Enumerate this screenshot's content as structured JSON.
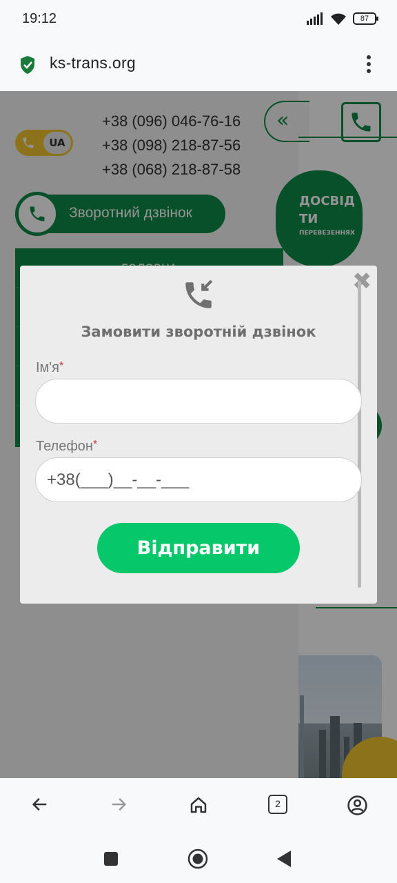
{
  "status_bar": {
    "time": "19:12",
    "battery": "87"
  },
  "browser": {
    "url": "ks-trans.org",
    "tab_count": "2"
  },
  "background_page": {
    "phones": [
      "+38 (096) 046-76-16",
      "+38 (098) 218-87-56",
      "+38 (068) 218-87-58"
    ],
    "language": "UA",
    "callback_label": "Зворотний дзвінок",
    "menu_first": "ГОЛОВНА",
    "collapse_glyph": "«",
    "oval_line1": "ДОСВІД",
    "oval_line2": "ТИ",
    "oval_line3": "ПЕРЕВЕЗЕННЯХ"
  },
  "modal": {
    "title": "Замовити зворотній дзвінок",
    "close_glyph": "✖",
    "name_label": "Ім'я",
    "required_mark": "*",
    "name_value": "",
    "phone_label": "Телефон",
    "phone_placeholder": "+38(___)__-__-___",
    "submit_label": "Відправити"
  },
  "colors": {
    "brand_green": "#0f8a47",
    "submit_green": "#06c86b",
    "accent_yellow": "#f3c531"
  }
}
